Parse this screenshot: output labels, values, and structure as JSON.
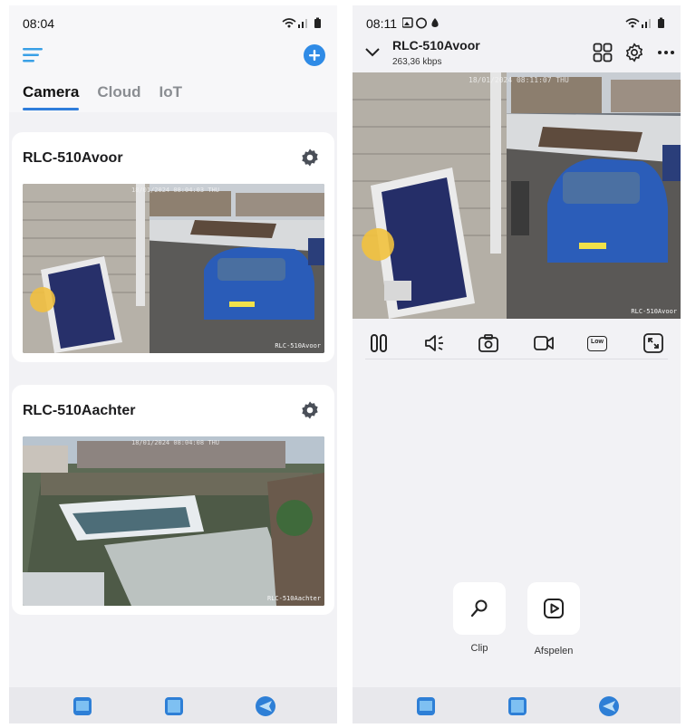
{
  "left_screen": {
    "status": {
      "time": "08:04"
    },
    "tabs": [
      {
        "label": "Camera",
        "active": true
      },
      {
        "label": "Cloud",
        "active": false
      },
      {
        "label": "IoT",
        "active": false
      }
    ],
    "cameras": [
      {
        "name": "RLC-510Avoor",
        "overlay_name": "RLC-510Avoor",
        "overlay_date": "18/01/2024 08:04:03 THU"
      },
      {
        "name": "RLC-510Aachter",
        "overlay_name": "RLC-510Aachter",
        "overlay_date": "18/01/2024 08:04:08 THU"
      }
    ]
  },
  "right_screen": {
    "status": {
      "time": "08:11"
    },
    "camera": {
      "name": "RLC-510Avoor",
      "bitrate": "263,36 kbps",
      "overlay_name": "RLC-510Avoor",
      "overlay_date": "18/01/2024 08:11:07 THU"
    },
    "controls": [
      {
        "icon": "pause-icon"
      },
      {
        "icon": "speaker-icon"
      },
      {
        "icon": "snapshot-icon"
      },
      {
        "icon": "record-icon"
      },
      {
        "icon": "quality-low-icon",
        "label": "Low"
      },
      {
        "icon": "fullscreen-icon"
      }
    ],
    "quick_actions": [
      {
        "label": "Clip",
        "icon": "search-icon"
      },
      {
        "label": "Afspelen",
        "icon": "play-icon"
      }
    ]
  },
  "colors": {
    "accent": "#2f7ddb",
    "background": "#f2f2f5",
    "card": "#ffffff"
  }
}
